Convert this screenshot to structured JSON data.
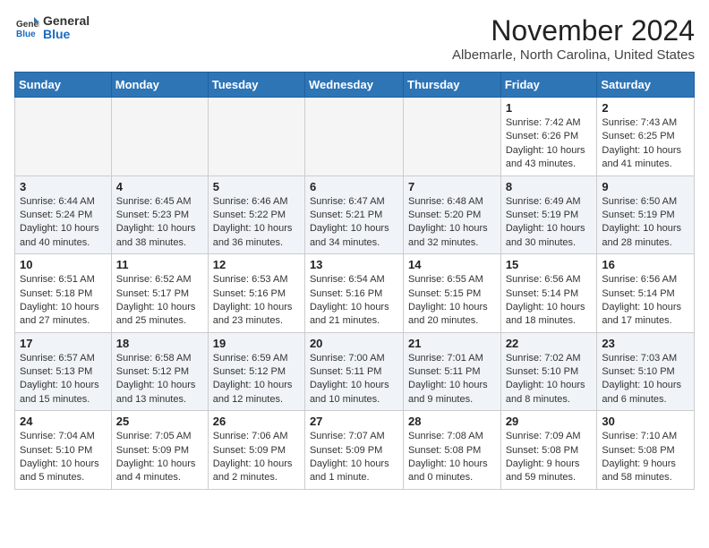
{
  "logo": {
    "general": "General",
    "blue": "Blue"
  },
  "header": {
    "month": "November 2024",
    "location": "Albemarle, North Carolina, United States"
  },
  "weekdays": [
    "Sunday",
    "Monday",
    "Tuesday",
    "Wednesday",
    "Thursday",
    "Friday",
    "Saturday"
  ],
  "weeks": [
    [
      {
        "day": "",
        "info": ""
      },
      {
        "day": "",
        "info": ""
      },
      {
        "day": "",
        "info": ""
      },
      {
        "day": "",
        "info": ""
      },
      {
        "day": "",
        "info": ""
      },
      {
        "day": "1",
        "info": "Sunrise: 7:42 AM\nSunset: 6:26 PM\nDaylight: 10 hours and 43 minutes."
      },
      {
        "day": "2",
        "info": "Sunrise: 7:43 AM\nSunset: 6:25 PM\nDaylight: 10 hours and 41 minutes."
      }
    ],
    [
      {
        "day": "3",
        "info": "Sunrise: 6:44 AM\nSunset: 5:24 PM\nDaylight: 10 hours and 40 minutes."
      },
      {
        "day": "4",
        "info": "Sunrise: 6:45 AM\nSunset: 5:23 PM\nDaylight: 10 hours and 38 minutes."
      },
      {
        "day": "5",
        "info": "Sunrise: 6:46 AM\nSunset: 5:22 PM\nDaylight: 10 hours and 36 minutes."
      },
      {
        "day": "6",
        "info": "Sunrise: 6:47 AM\nSunset: 5:21 PM\nDaylight: 10 hours and 34 minutes."
      },
      {
        "day": "7",
        "info": "Sunrise: 6:48 AM\nSunset: 5:20 PM\nDaylight: 10 hours and 32 minutes."
      },
      {
        "day": "8",
        "info": "Sunrise: 6:49 AM\nSunset: 5:19 PM\nDaylight: 10 hours and 30 minutes."
      },
      {
        "day": "9",
        "info": "Sunrise: 6:50 AM\nSunset: 5:19 PM\nDaylight: 10 hours and 28 minutes."
      }
    ],
    [
      {
        "day": "10",
        "info": "Sunrise: 6:51 AM\nSunset: 5:18 PM\nDaylight: 10 hours and 27 minutes."
      },
      {
        "day": "11",
        "info": "Sunrise: 6:52 AM\nSunset: 5:17 PM\nDaylight: 10 hours and 25 minutes."
      },
      {
        "day": "12",
        "info": "Sunrise: 6:53 AM\nSunset: 5:16 PM\nDaylight: 10 hours and 23 minutes."
      },
      {
        "day": "13",
        "info": "Sunrise: 6:54 AM\nSunset: 5:16 PM\nDaylight: 10 hours and 21 minutes."
      },
      {
        "day": "14",
        "info": "Sunrise: 6:55 AM\nSunset: 5:15 PM\nDaylight: 10 hours and 20 minutes."
      },
      {
        "day": "15",
        "info": "Sunrise: 6:56 AM\nSunset: 5:14 PM\nDaylight: 10 hours and 18 minutes."
      },
      {
        "day": "16",
        "info": "Sunrise: 6:56 AM\nSunset: 5:14 PM\nDaylight: 10 hours and 17 minutes."
      }
    ],
    [
      {
        "day": "17",
        "info": "Sunrise: 6:57 AM\nSunset: 5:13 PM\nDaylight: 10 hours and 15 minutes."
      },
      {
        "day": "18",
        "info": "Sunrise: 6:58 AM\nSunset: 5:12 PM\nDaylight: 10 hours and 13 minutes."
      },
      {
        "day": "19",
        "info": "Sunrise: 6:59 AM\nSunset: 5:12 PM\nDaylight: 10 hours and 12 minutes."
      },
      {
        "day": "20",
        "info": "Sunrise: 7:00 AM\nSunset: 5:11 PM\nDaylight: 10 hours and 10 minutes."
      },
      {
        "day": "21",
        "info": "Sunrise: 7:01 AM\nSunset: 5:11 PM\nDaylight: 10 hours and 9 minutes."
      },
      {
        "day": "22",
        "info": "Sunrise: 7:02 AM\nSunset: 5:10 PM\nDaylight: 10 hours and 8 minutes."
      },
      {
        "day": "23",
        "info": "Sunrise: 7:03 AM\nSunset: 5:10 PM\nDaylight: 10 hours and 6 minutes."
      }
    ],
    [
      {
        "day": "24",
        "info": "Sunrise: 7:04 AM\nSunset: 5:10 PM\nDaylight: 10 hours and 5 minutes."
      },
      {
        "day": "25",
        "info": "Sunrise: 7:05 AM\nSunset: 5:09 PM\nDaylight: 10 hours and 4 minutes."
      },
      {
        "day": "26",
        "info": "Sunrise: 7:06 AM\nSunset: 5:09 PM\nDaylight: 10 hours and 2 minutes."
      },
      {
        "day": "27",
        "info": "Sunrise: 7:07 AM\nSunset: 5:09 PM\nDaylight: 10 hours and 1 minute."
      },
      {
        "day": "28",
        "info": "Sunrise: 7:08 AM\nSunset: 5:08 PM\nDaylight: 10 hours and 0 minutes."
      },
      {
        "day": "29",
        "info": "Sunrise: 7:09 AM\nSunset: 5:08 PM\nDaylight: 9 hours and 59 minutes."
      },
      {
        "day": "30",
        "info": "Sunrise: 7:10 AM\nSunset: 5:08 PM\nDaylight: 9 hours and 58 minutes."
      }
    ]
  ]
}
